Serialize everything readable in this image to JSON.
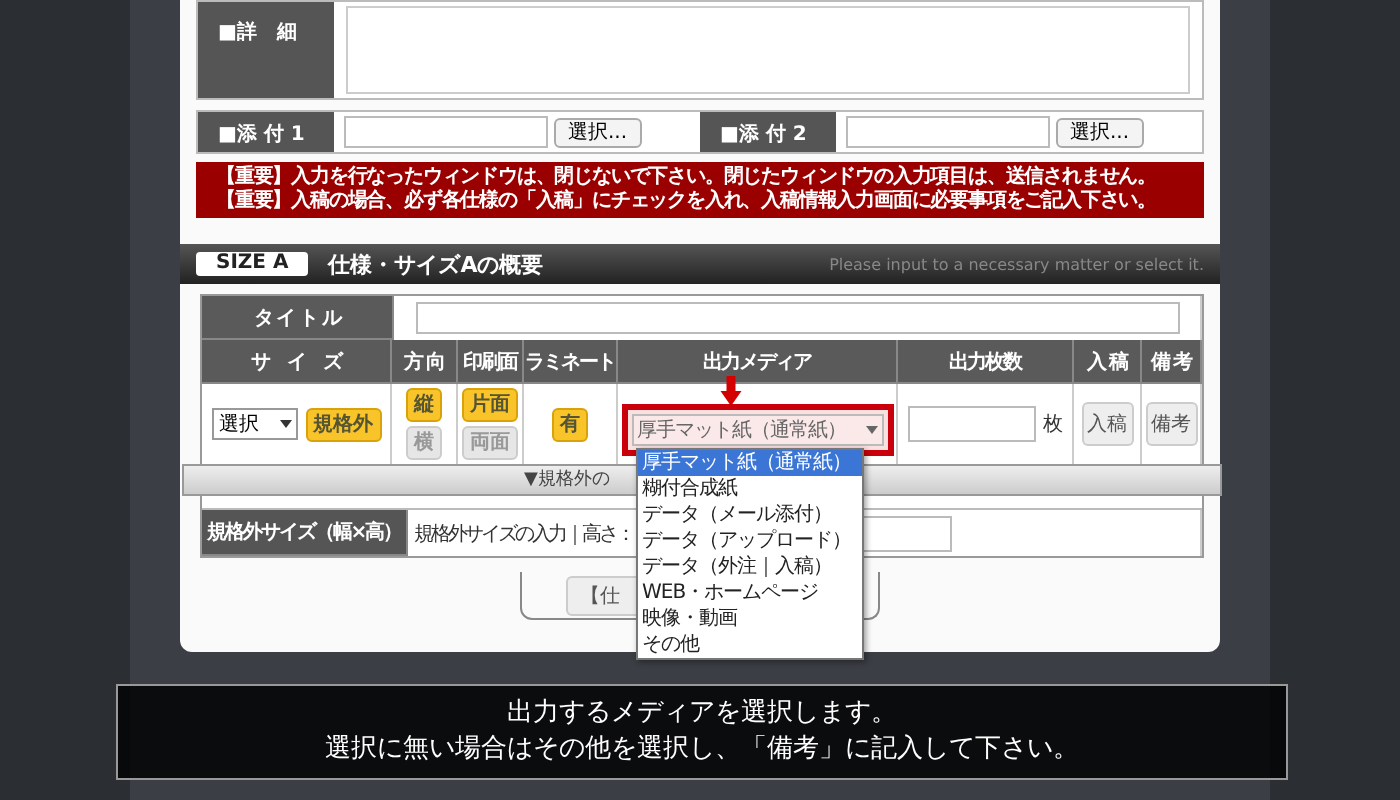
{
  "detail": {
    "label": "■詳　細"
  },
  "attachments": [
    {
      "label": "■添 付 1",
      "button": "選択..."
    },
    {
      "label": "■添 付 2",
      "button": "選択..."
    }
  ],
  "notices": [
    "【重要】入力を行なったウィンドウは、閉じないで下さい。閉じたウィンドウの入力項目は、送信されません。",
    "【重要】入稿の場合、必ず各仕様の「入稿」にチェックを入れ、入稿情報入力画面に必要事項をご記入下さい。"
  ],
  "section": {
    "badge": "SIZE A",
    "title": "仕様・サイズAの概要",
    "hint": "Please input to a necessary matter or select it."
  },
  "title_row": {
    "label": "タ イ ト ル"
  },
  "columns": [
    "サ　イ　ズ",
    "方 向",
    "印刷面",
    "ラミネート",
    "出力メディア",
    "出力枚数",
    "入 稿",
    "備 考"
  ],
  "size": {
    "select": "選択",
    "button": "規格外"
  },
  "orientation": [
    {
      "label": "縦",
      "selected": true
    },
    {
      "label": "横",
      "selected": false
    }
  ],
  "sides": [
    {
      "label": "片面",
      "selected": true
    },
    {
      "label": "両面",
      "selected": false
    }
  ],
  "laminate": {
    "label": "有",
    "selected": true
  },
  "media": {
    "value": "厚手マット紙（通常紙）",
    "options": [
      {
        "label": "厚手マット紙（通常紙）",
        "selected": true
      },
      {
        "label": "糊付合成紙",
        "selected": false
      },
      {
        "label": "データ（メール添付）",
        "selected": false
      },
      {
        "label": "データ（アップロード）",
        "selected": false
      },
      {
        "label": "データ（外注｜入稿）",
        "selected": false
      },
      {
        "label": "WEB・ホームページ",
        "selected": false
      },
      {
        "label": "映像・動画",
        "selected": false
      },
      {
        "label": "その他",
        "selected": false
      }
    ]
  },
  "count_unit": "枚",
  "submit_button": "入稿",
  "remarks_button": "備考",
  "toggle_bar": "▼規格外の",
  "custom_size": {
    "label": "規格外サイズ（幅×高）",
    "text": "規格外サイズの入力｜高さ："
  },
  "bottom_button": "【仕",
  "caption": [
    "出力するメディアを選択します。",
    "選択に無い場合はその他を選択し、「備考」に記入して下さい。"
  ]
}
